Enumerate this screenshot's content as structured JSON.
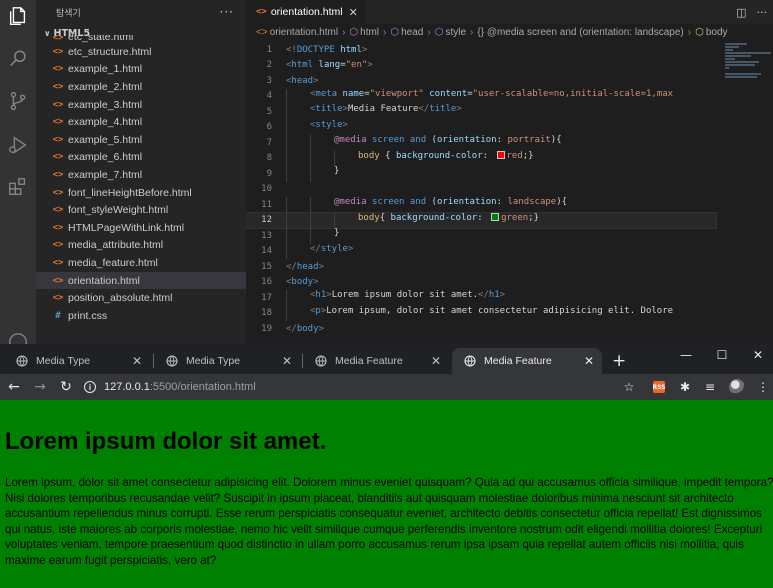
{
  "vscode": {
    "explorer": {
      "title": "탐색기",
      "more": "···",
      "folder": "HTML5"
    },
    "files": [
      {
        "name": "etc_state.html",
        "type": "html"
      },
      {
        "name": "etc_structure.html",
        "type": "html"
      },
      {
        "name": "example_1.html",
        "type": "html"
      },
      {
        "name": "example_2.html",
        "type": "html"
      },
      {
        "name": "example_3.html",
        "type": "html"
      },
      {
        "name": "example_4.html",
        "type": "html"
      },
      {
        "name": "example_5.html",
        "type": "html"
      },
      {
        "name": "example_6.html",
        "type": "html"
      },
      {
        "name": "example_7.html",
        "type": "html"
      },
      {
        "name": "font_lineHeightBefore.html",
        "type": "html"
      },
      {
        "name": "font_styleWeight.html",
        "type": "html"
      },
      {
        "name": "HTMLPageWithLink.html",
        "type": "html"
      },
      {
        "name": "media_attribute.html",
        "type": "html"
      },
      {
        "name": "media_feature.html",
        "type": "html"
      },
      {
        "name": "orientation.html",
        "type": "html",
        "active": true
      },
      {
        "name": "position_absolute.html",
        "type": "html"
      },
      {
        "name": "print.css",
        "type": "css"
      }
    ],
    "tab": {
      "label": "orientation.html",
      "close": "✕"
    },
    "breadcrumb": [
      "orientation.html",
      "html",
      "head",
      "style",
      "{} @media screen and (orientation: landscape)",
      "body"
    ],
    "code_lines": [
      {
        "n": "1",
        "indent": 0,
        "html": "<span class='k-pun'>&lt;!</span><span class='k-tag'>DOCTYPE</span> <span class='k-attr'>html</span><span class='k-pun'>&gt;</span>"
      },
      {
        "n": "2",
        "indent": 0,
        "html": "<span class='k-pun'>&lt;</span><span class='k-tag'>html</span> <span class='k-attr'>lang</span>=<span class='k-str'>\"en\"</span><span class='k-pun'>&gt;</span>"
      },
      {
        "n": "3",
        "indent": 0,
        "html": "<span class='k-pun'>&lt;</span><span class='k-tag'>head</span><span class='k-pun'>&gt;</span>"
      },
      {
        "n": "4",
        "indent": 1,
        "html": "<span class='k-pun'>&lt;</span><span class='k-tag'>meta</span> <span class='k-attr'>name</span>=<span class='k-str'>\"viewport\"</span> <span class='k-attr'>content</span>=<span class='k-str'>\"user-scalable=no,initial-scale=1,max</span>"
      },
      {
        "n": "5",
        "indent": 1,
        "html": "<span class='k-pun'>&lt;</span><span class='k-tag'>title</span><span class='k-pun'>&gt;</span><span class='k-txt'>Media Feature</span><span class='k-pun'>&lt;/</span><span class='k-tag'>title</span><span class='k-pun'>&gt;</span>"
      },
      {
        "n": "6",
        "indent": 1,
        "html": "<span class='k-pun'>&lt;</span><span class='k-tag'>style</span><span class='k-pun'>&gt;</span>"
      },
      {
        "n": "7",
        "indent": 2,
        "html": "<span class='k-at'>@media</span> <span class='k-kw'>screen</span> <span class='k-kw'>and</span> (<span class='k-prop'>orientation</span>: <span class='k-val'>portrait</span>){"
      },
      {
        "n": "8",
        "indent": 3,
        "html": "<span class='k-sel'>body</span> { <span class='k-prop'>background-color</span>: <span class='swatch' style='background:#ff0000'></span><span class='k-val'>red</span>;}"
      },
      {
        "n": "9",
        "indent": 2,
        "html": "}"
      },
      {
        "n": "10",
        "indent": 0,
        "html": ""
      },
      {
        "n": "11",
        "indent": 2,
        "html": "<span class='k-at'>@media</span> <span class='k-kw'>screen</span> <span class='k-kw'>and</span> (<span class='k-prop'>orientation</span>: <span class='k-val'>landscape</span>){"
      },
      {
        "n": "12",
        "indent": 3,
        "cur": true,
        "html": "<span class='k-sel'>body</span>{ <span class='k-prop'>background-color</span>: <span class='swatch' style='background:#008000'></span><span class='k-val'>green</span>;}"
      },
      {
        "n": "13",
        "indent": 2,
        "html": "}"
      },
      {
        "n": "14",
        "indent": 1,
        "html": "<span class='k-pun'>&lt;/</span><span class='k-tag'>style</span><span class='k-pun'>&gt;</span>"
      },
      {
        "n": "15",
        "indent": 0,
        "html": "<span class='k-pun'>&lt;/</span><span class='k-tag'>head</span><span class='k-pun'>&gt;</span>"
      },
      {
        "n": "16",
        "indent": 0,
        "html": "<span class='k-pun'>&lt;</span><span class='k-tag'>body</span><span class='k-pun'>&gt;</span>"
      },
      {
        "n": "17",
        "indent": 1,
        "html": "<span class='k-pun'>&lt;</span><span class='k-tag'>h1</span><span class='k-pun'>&gt;</span><span class='k-txt'>Lorem ipsum dolor sit amet.</span><span class='k-pun'>&lt;/</span><span class='k-tag'>h1</span><span class='k-pun'>&gt;</span>"
      },
      {
        "n": "18",
        "indent": 1,
        "html": "<span class='k-pun'>&lt;</span><span class='k-tag'>p</span><span class='k-pun'>&gt;</span><span class='k-txt'>Lorem ipsum, dolor sit amet consectetur adipisicing elit. Dolore</span>"
      },
      {
        "n": "19",
        "indent": 0,
        "html": "<span class='k-pun'>&lt;/</span><span class='k-tag'>body</span><span class='k-pun'>&gt;</span>"
      }
    ]
  },
  "browser": {
    "tabs": [
      {
        "title": "Media Type"
      },
      {
        "title": "Media Type"
      },
      {
        "title": "Media Feature"
      },
      {
        "title": "Media Feature",
        "active": true
      }
    ],
    "url_host": "127.0.0.1",
    "url_path": ":5500/orientation.html",
    "ext_label": "RSS"
  },
  "page": {
    "bg_color": "#008000",
    "heading": "Lorem ipsum dolor sit amet.",
    "paragraph": "Lorem ipsum, dolor sit amet consectetur adipisicing elit. Dolorem minus eveniet quisquam? Quia ad qui accusamus officia similique, impedit tempora? Nisi dolores temporibus recusandae velit? Suscipit in ipsum placeat, blanditiis aut quisquam molestiae doloribus minima nesciunt sit architecto accusantium repellendus minus corrupti. Esse rerum perspiciatis consequatur eveniet, architecto debitis consectetur officia repellat! Est dignissimos qui natus, iste maiores ab corporis molestiae, nemo hic velit similique cumque perferendis inventore nostrum odit eligendi mollitia dolores! Excepturi voluptates veniam, tempore praesentium quod distinctio in ullam porro accusamus rerum ipsa ipsam quia repellat autem officiis nisi mollitia, quis maxime earum fugit perspiciatis, vero at?"
  }
}
